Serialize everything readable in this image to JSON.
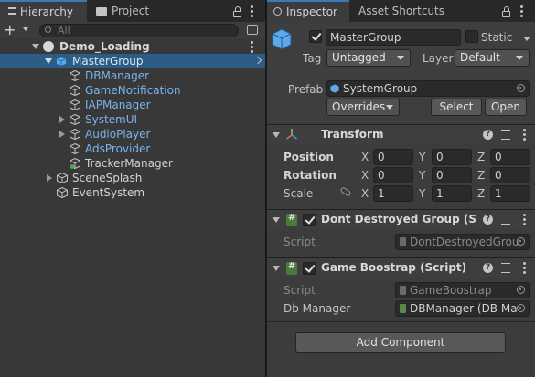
{
  "hierarchy": {
    "tab_label": "Hierarchy",
    "project_tab_label": "Project",
    "search_placeholder": "All",
    "add_label": "+",
    "rows": [
      {
        "label": "Demo_Loading",
        "style": "scene"
      },
      {
        "label": "MasterGroup",
        "style": "selected"
      },
      {
        "label": "DBManager",
        "style": "blue"
      },
      {
        "label": "GameNotification",
        "style": "blue"
      },
      {
        "label": "IAPManager",
        "style": "blue"
      },
      {
        "label": "SystemUI",
        "style": "blue"
      },
      {
        "label": "AudioPlayer",
        "style": "blue"
      },
      {
        "label": "AdsProvider",
        "style": "blue"
      },
      {
        "label": "TrackerManager",
        "style": "white"
      },
      {
        "label": "SceneSplash",
        "style": "white"
      },
      {
        "label": "EventSystem",
        "style": "white"
      }
    ]
  },
  "inspector": {
    "tab_label": "Inspector",
    "shortcuts_tab_label": "Asset Shortcuts",
    "object_name": "MasterGroup",
    "static_label": "Static",
    "tag_label": "Tag",
    "tag_value": "Untagged",
    "layer_label": "Layer",
    "layer_value": "Default",
    "prefab_label": "Prefab",
    "prefab_value": "SystemGroup",
    "overrides_label": "Overrides",
    "select_label": "Select",
    "open_label": "Open",
    "transform": {
      "title": "Transform",
      "position_label": "Position",
      "rotation_label": "Rotation",
      "scale_label": "Scale",
      "x": "X",
      "y": "Y",
      "z": "Z",
      "position": [
        "0",
        "0",
        "0"
      ],
      "rotation": [
        "0",
        "0",
        "0"
      ],
      "scale": [
        "1",
        "1",
        "1"
      ]
    },
    "dont_destroy": {
      "title": "Dont Destroyed Group (Scrip",
      "script_label": "Script",
      "script_value": "DontDestroyedGrou"
    },
    "game_bootstrap": {
      "title": "Game Boostrap (Script)",
      "script_label": "Script",
      "script_value": "GameBoostrap",
      "db_label": "Db Manager",
      "db_value": "DBManager (DB Ma"
    },
    "add_component_label": "Add Component"
  },
  "colors": {
    "selected_row": "#2c5d87",
    "prefab_blue": "#7ab3ee",
    "accent": "#3a79bb"
  }
}
